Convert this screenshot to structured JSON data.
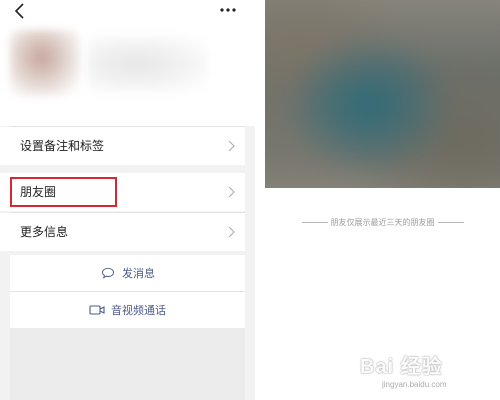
{
  "header": {
    "back_icon": "chevron-left-icon",
    "more_icon": "ellipsis-icon"
  },
  "menu": {
    "remark_tags": "设置备注和标签",
    "moments": "朋友圈",
    "more_info": "更多信息"
  },
  "actions": {
    "send_message": "发消息",
    "send_message_icon": "chat-bubble-icon",
    "av_call": "音视频通话",
    "av_call_icon": "video-camera-icon"
  },
  "moments_page": {
    "notice": "朋友仅展示最近三天的朋友圈"
  },
  "watermark": {
    "brand": "Bai 经验",
    "url": "jingyan.baidu.com"
  },
  "colors": {
    "highlight": "#d9262f",
    "link": "#4a5b8c"
  }
}
